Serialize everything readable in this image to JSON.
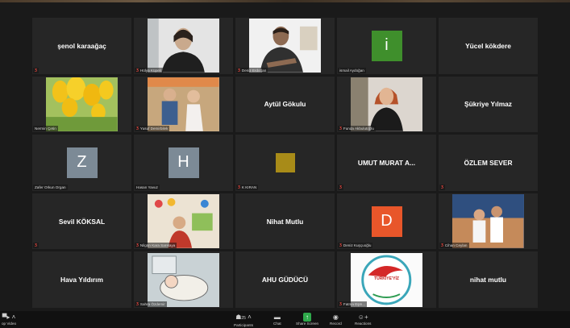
{
  "colors": {
    "bg": "#1a1a1a",
    "tile": "#262626",
    "mic": "#e0433b",
    "share": "#2ea84a"
  },
  "tiles": [
    {
      "name": "şenol karaağaç",
      "label": ""
    },
    {
      "label": "Hülya Küpeli",
      "icon": "webcam-person"
    },
    {
      "label": "Deniz Erdoğan",
      "icon": "webcam-person"
    },
    {
      "label": "ismail Aydoğan",
      "letter": "i",
      "color": "#3f8f2c"
    },
    {
      "name": "Yücel kökdere",
      "label": ""
    },
    {
      "label": "Nermin Çetin",
      "icon": "tulip-photo"
    },
    {
      "label": "Yusuf Demirbilek",
      "icon": "children-photo"
    },
    {
      "name": "Aytül Gökulu",
      "label": ""
    },
    {
      "label": "Funda Akbulutoğlu",
      "icon": "woman-photo"
    },
    {
      "name": "Şükriye Yılmaz",
      "label": ""
    },
    {
      "label": "Zafer Orkun Organ",
      "letter": "Z",
      "color": "#7c8a96"
    },
    {
      "label": "Hasan Yavuz",
      "letter": "H",
      "color": "#7c8a96"
    },
    {
      "label": "K KIRAN",
      "letter": "",
      "color": "#a88b18"
    },
    {
      "name": "UMUT MURAT A...",
      "label": ""
    },
    {
      "name": "ÖZLEM SEVER",
      "label": ""
    },
    {
      "name": "Sevil KÖKSAL",
      "label": ""
    },
    {
      "label": "Nilgün Kara Sarıkaya",
      "icon": "classroom-photo"
    },
    {
      "name": "Nihat Mutlu",
      "label": ""
    },
    {
      "label": "Deniz Kuşçuoğlu",
      "letter": "D",
      "color": "#e8562a"
    },
    {
      "label": "Cihan Ceylan",
      "icon": "couple-photo"
    },
    {
      "name": "Hava Yıldırım",
      "label": ""
    },
    {
      "label": "Sahra Özdemir",
      "icon": "cartoon-photo"
    },
    {
      "name": "AHU GÜDÜCÜ",
      "label": ""
    },
    {
      "label": "Fatma Eşm...",
      "icon": "logo-photo",
      "logo": "TÜRKİYE'YİZ"
    },
    {
      "name": "nihat mutlu",
      "label": ""
    }
  ],
  "toolbar": {
    "stop_video": "op Video",
    "participants": "Participants",
    "participants_count": "25",
    "chat": "Chat",
    "share_screen": "Share Screen",
    "record": "Record",
    "reactions": "Reactions"
  }
}
